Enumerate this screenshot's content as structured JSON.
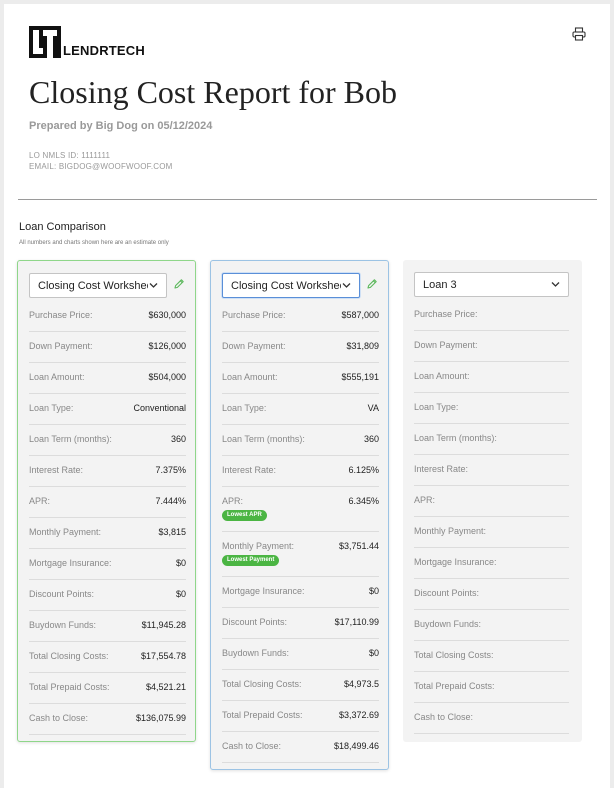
{
  "brand": {
    "name": "LENDRTECH"
  },
  "header": {
    "title": "Closing Cost Report for Bob",
    "prepared_by": "Prepared by Big Dog on 05/12/2024",
    "lo_nmls": "LO NMLS ID: 1111111",
    "email": "EMAIL: BIGDOG@WOOFWOOF.COM"
  },
  "section": {
    "title": "Loan Comparison",
    "subtitle": "All numbers and charts shown here are an estimate only"
  },
  "colors": {
    "best_green": "#4bb543",
    "card1_border": "#8fd68a",
    "card2_border": "#9cc3e4"
  },
  "loans": [
    {
      "selector_value": "Closing Cost Worksheet",
      "rows": [
        {
          "label": "Purchase Price:",
          "value": "$630,000"
        },
        {
          "label": "Down Payment:",
          "value": "$126,000"
        },
        {
          "label": "Loan Amount:",
          "value": "$504,000"
        },
        {
          "label": "Loan Type:",
          "value": "Conventional"
        },
        {
          "label": "Loan Term (months):",
          "value": "360"
        },
        {
          "label": "Interest Rate:",
          "value": "7.375%"
        },
        {
          "label": "APR:",
          "value": "7.444%"
        },
        {
          "label": "Monthly Payment:",
          "value": "$3,815"
        },
        {
          "label": "Mortgage Insurance:",
          "value": "$0"
        },
        {
          "label": "Discount Points:",
          "value": "$0"
        },
        {
          "label": "Buydown Funds:",
          "value": "$11,945.28"
        },
        {
          "label": "Total Closing Costs:",
          "value": "$17,554.78"
        },
        {
          "label": "Total Prepaid Costs:",
          "value": "$4,521.21"
        },
        {
          "label": "Cash to Close:",
          "value": "$136,075.99"
        }
      ]
    },
    {
      "selector_value": "Closing Cost Worksheet",
      "rows": [
        {
          "label": "Purchase Price:",
          "value": "$587,000"
        },
        {
          "label": "Down Payment:",
          "value": "$31,809"
        },
        {
          "label": "Loan Amount:",
          "value": "$555,191"
        },
        {
          "label": "Loan Type:",
          "value": "VA"
        },
        {
          "label": "Loan Term (months):",
          "value": "360"
        },
        {
          "label": "Interest Rate:",
          "value": "6.125%"
        },
        {
          "label": "APR:",
          "value": "6.345%",
          "badge": "Lowest APR"
        },
        {
          "label": "Monthly Payment:",
          "value": "$3,751.44",
          "badge": "Lowest Payment"
        },
        {
          "label": "Mortgage Insurance:",
          "value": "$0"
        },
        {
          "label": "Discount Points:",
          "value": "$17,110.99"
        },
        {
          "label": "Buydown Funds:",
          "value": "$0"
        },
        {
          "label": "Total Closing Costs:",
          "value": "$4,973.5"
        },
        {
          "label": "Total Prepaid Costs:",
          "value": "$3,372.69"
        },
        {
          "label": "Cash to Close:",
          "value": "$18,499.46"
        }
      ]
    },
    {
      "selector_value": "Loan 3",
      "rows": [
        {
          "label": "Purchase Price:",
          "value": ""
        },
        {
          "label": "Down Payment:",
          "value": ""
        },
        {
          "label": "Loan Amount:",
          "value": ""
        },
        {
          "label": "Loan Type:",
          "value": ""
        },
        {
          "label": "Loan Term (months):",
          "value": ""
        },
        {
          "label": "Interest Rate:",
          "value": ""
        },
        {
          "label": "APR:",
          "value": ""
        },
        {
          "label": "Monthly Payment:",
          "value": ""
        },
        {
          "label": "Mortgage Insurance:",
          "value": ""
        },
        {
          "label": "Discount Points:",
          "value": ""
        },
        {
          "label": "Buydown Funds:",
          "value": ""
        },
        {
          "label": "Total Closing Costs:",
          "value": ""
        },
        {
          "label": "Total Prepaid Costs:",
          "value": ""
        },
        {
          "label": "Cash to Close:",
          "value": ""
        }
      ]
    }
  ]
}
